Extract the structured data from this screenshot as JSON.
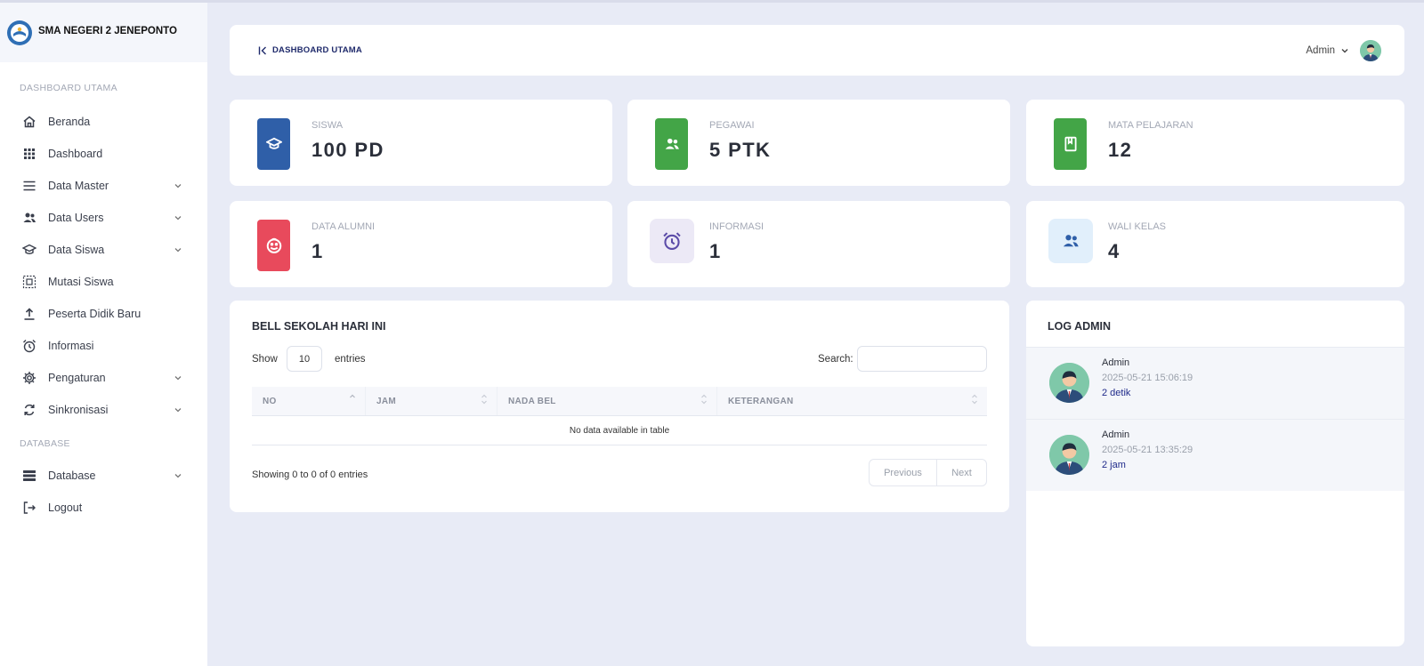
{
  "sidebar": {
    "brand": "SMA NEGERI 2 JENEPONTO",
    "section_main": "DASHBOARD UTAMA",
    "section_db": "DATABASE",
    "items": [
      {
        "label": "Beranda",
        "icon": "home-icon",
        "has_sub": false
      },
      {
        "label": "Dashboard",
        "icon": "grid-icon",
        "has_sub": false
      },
      {
        "label": "Data Master",
        "icon": "list-icon",
        "has_sub": true
      },
      {
        "label": "Data Users",
        "icon": "users-icon",
        "has_sub": true
      },
      {
        "label": "Data Siswa",
        "icon": "graduation-cap-icon",
        "has_sub": true
      },
      {
        "label": "Mutasi Siswa",
        "icon": "transfer-icon",
        "has_sub": false
      },
      {
        "label": "Peserta Didik Baru",
        "icon": "upload-icon",
        "has_sub": false
      },
      {
        "label": "Informasi",
        "icon": "alarm-icon",
        "has_sub": false
      },
      {
        "label": "Pengaturan",
        "icon": "gear-icon",
        "has_sub": true
      },
      {
        "label": "Sinkronisasi",
        "icon": "sync-icon",
        "has_sub": true
      }
    ],
    "db_items": [
      {
        "label": "Database",
        "icon": "database-icon",
        "has_sub": true
      },
      {
        "label": "Logout",
        "icon": "logout-icon",
        "has_sub": false
      }
    ]
  },
  "header": {
    "breadcrumb": "DASHBOARD UTAMA",
    "user": "Admin"
  },
  "stats": [
    {
      "label": "SISWA",
      "value": "100 PD",
      "color": "#2f5fa8",
      "icon": "graduation-cap-icon"
    },
    {
      "label": "PEGAWAI",
      "value": "5 PTK",
      "color": "#43a547",
      "icon": "users-icon"
    },
    {
      "label": "MATA PELAJARAN",
      "value": "12",
      "color": "#43a547",
      "icon": "book-icon"
    },
    {
      "label": "DATA ALUMNI",
      "value": "1",
      "color": "#e84a5c",
      "icon": "face-icon"
    },
    {
      "label": "INFORMASI",
      "value": "1",
      "color": "#ece9f6",
      "icon": "alarm-icon"
    },
    {
      "label": "WALI KELAS",
      "value": "4",
      "color": "#e1effb",
      "icon": "users-icon"
    }
  ],
  "bell": {
    "title": "BELL SEKOLAH HARI INI",
    "show_label": "Show",
    "entries_value": "10",
    "entries_label": "entries",
    "search_label": "Search:",
    "columns": [
      "NO",
      "JAM",
      "NADA BEL",
      "KETERANGAN"
    ],
    "empty_text": "No data available in table",
    "showing": "Showing 0 to 0 of 0 entries",
    "prev": "Previous",
    "next": "Next"
  },
  "log": {
    "title": "LOG ADMIN",
    "items": [
      {
        "name": "Admin",
        "time": "2025-05-21 15:06:19",
        "ago": "2 detik"
      },
      {
        "name": "Admin",
        "time": "2025-05-21 13:35:29",
        "ago": "2 jam"
      }
    ]
  }
}
